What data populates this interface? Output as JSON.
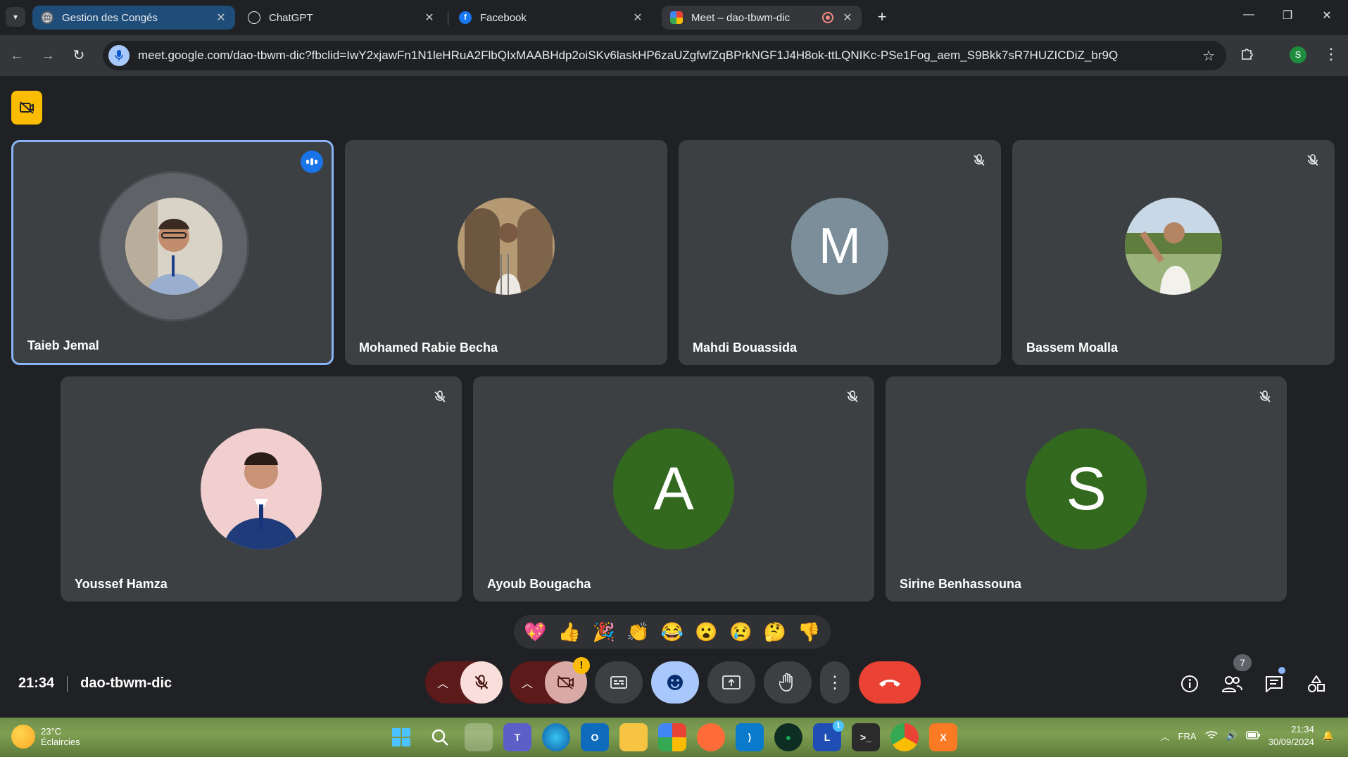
{
  "browser": {
    "tabs": [
      {
        "title": "Gestion des Congés",
        "active": false
      },
      {
        "title": "ChatGPT",
        "active": false
      },
      {
        "title": "Facebook",
        "active": false
      },
      {
        "title": "Meet – dao-tbwm-dic",
        "active": true
      }
    ],
    "url": "meet.google.com/dao-tbwm-dic?fbclid=IwY2xjawFn1N1leHRuA2FlbQIxMAABHdp2oiSKv6laskHP6zaUZgfwfZqBPrkNGF1J4H8ok-ttLQNIKc-PSe1Fog_aem_S9Bkk7sR7HUZICDiZ_br9Q",
    "profile_initial": "S"
  },
  "meet": {
    "participants": [
      {
        "name": "Taieb Jemal",
        "speaking": true,
        "muted": false,
        "avatar": "photo",
        "avatar_color": "#8a7f73"
      },
      {
        "name": "Mohamed Rabie Becha",
        "speaking": false,
        "muted": false,
        "avatar": "photo",
        "avatar_color": "#a08767"
      },
      {
        "name": "Mahdi Bouassida",
        "speaking": false,
        "muted": true,
        "avatar": "M",
        "avatar_color": "#7b8e99"
      },
      {
        "name": "Bassem Moalla",
        "speaking": false,
        "muted": true,
        "avatar": "photo",
        "avatar_color": "#6f8a5a"
      },
      {
        "name": "Youssef Hamza",
        "speaking": false,
        "muted": true,
        "avatar": "photo",
        "avatar_color": "#e9b8b8"
      },
      {
        "name": "Ayoub Bougacha",
        "speaking": false,
        "muted": true,
        "avatar": "A",
        "avatar_color": "#33691e"
      },
      {
        "name": "Sirine Benhassouna",
        "speaking": false,
        "muted": true,
        "avatar": "S",
        "avatar_color": "#33691e"
      }
    ],
    "reactions": [
      "💖",
      "👍",
      "🎉",
      "👏",
      "😂",
      "😮",
      "😢",
      "🤔",
      "👎"
    ],
    "time": "21:34",
    "meeting_code": "dao-tbwm-dic",
    "participant_count": "7",
    "camera_warning": "!",
    "colors": {
      "end_call": "#ea4335",
      "active_control": "#a8c7fa",
      "speaking_border": "#8ab4f8",
      "muted_control": "#f9dedc"
    }
  },
  "taskbar": {
    "temperature": "23°C",
    "weather": "Éclaircies",
    "language": "FRA",
    "time": "21:34",
    "date": "30/09/2024",
    "badge_count": "1"
  }
}
